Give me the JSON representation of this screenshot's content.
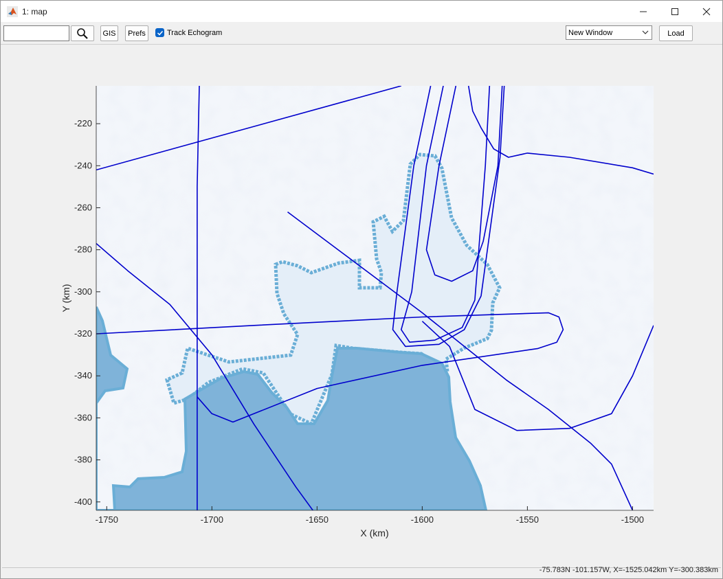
{
  "window": {
    "title": "1: map"
  },
  "toolbar": {
    "search_value": "",
    "gis_label": "GIS",
    "prefs_label": "Prefs",
    "track_echogram_label": "Track Echogram",
    "track_echogram_checked": true,
    "new_window_select": "New Window",
    "load_label": "Load"
  },
  "status": {
    "text": "-75.783N -101.157W, X=-1525.042km Y=-300.383km"
  },
  "colors": {
    "track": "#0000cc",
    "ocean": "#7fb3d9",
    "ice_shelf": "#e4eef8",
    "coast_edge": "#6aaed6",
    "land": "#f3f6fb"
  },
  "chart_data": {
    "type": "map",
    "xlabel": "X (km)",
    "ylabel": "Y (km)",
    "xlim": [
      -1755,
      -1490
    ],
    "ylim": [
      -404,
      -202
    ],
    "x_ticks": [
      -1750,
      -1700,
      -1650,
      -1600,
      -1550,
      -1500
    ],
    "y_ticks": [
      -220,
      -240,
      -260,
      -280,
      -300,
      -320,
      -340,
      -360,
      -380,
      -400
    ],
    "tracks": [
      [
        [
          -1755,
          -242
        ],
        [
          -1610,
          -202
        ]
      ],
      [
        [
          -1706,
          -202
        ],
        [
          -1707,
          -250
        ],
        [
          -1707,
          -404
        ]
      ],
      [
        [
          -1755,
          -277
        ],
        [
          -1740,
          -290
        ],
        [
          -1720,
          -306
        ],
        [
          -1700,
          -330
        ],
        [
          -1680,
          -363
        ],
        [
          -1660,
          -393
        ],
        [
          -1652,
          -404
        ]
      ],
      [
        [
          -1755,
          -320
        ],
        [
          -1680,
          -316
        ],
        [
          -1600,
          -312
        ],
        [
          -1540,
          -310
        ],
        [
          -1535,
          -312
        ],
        [
          -1533,
          -318
        ],
        [
          -1536,
          -324
        ],
        [
          -1545,
          -327
        ],
        [
          -1600,
          -335
        ],
        [
          -1650,
          -346
        ],
        [
          -1690,
          -362
        ],
        [
          -1700,
          -358
        ],
        [
          -1707,
          -350
        ]
      ],
      [
        [
          -1664,
          -262
        ],
        [
          -1640,
          -280
        ],
        [
          -1600,
          -310
        ],
        [
          -1560,
          -342
        ],
        [
          -1540,
          -356
        ],
        [
          -1520,
          -372
        ],
        [
          -1510,
          -382
        ],
        [
          -1500,
          -404
        ]
      ],
      [
        [
          -1590,
          -202
        ],
        [
          -1598,
          -240
        ],
        [
          -1605,
          -300
        ],
        [
          -1610,
          -318
        ],
        [
          -1606,
          -324
        ],
        [
          -1594,
          -323
        ],
        [
          -1581,
          -317
        ],
        [
          -1575,
          -304
        ],
        [
          -1570,
          -240
        ],
        [
          -1568,
          -202
        ]
      ],
      [
        [
          -1596,
          -202
        ],
        [
          -1604,
          -240
        ],
        [
          -1612,
          -300
        ],
        [
          -1614,
          -318
        ],
        [
          -1608,
          -326
        ],
        [
          -1592,
          -325
        ],
        [
          -1580,
          -318
        ],
        [
          -1572,
          -302
        ],
        [
          -1563,
          -236
        ],
        [
          -1561,
          -202
        ]
      ],
      [
        [
          -1584,
          -202
        ],
        [
          -1592,
          -240
        ],
        [
          -1598,
          -280
        ],
        [
          -1594,
          -292
        ],
        [
          -1586,
          -295
        ],
        [
          -1576,
          -290
        ],
        [
          -1571,
          -276
        ],
        [
          -1564,
          -240
        ],
        [
          -1562,
          -202
        ]
      ],
      [
        [
          -1578,
          -202
        ],
        [
          -1576,
          -214
        ],
        [
          -1572,
          -222
        ],
        [
          -1566,
          -232
        ],
        [
          -1559,
          -236
        ],
        [
          -1550,
          -234
        ],
        [
          -1530,
          -236
        ],
        [
          -1500,
          -241
        ],
        [
          -1490,
          -244
        ]
      ],
      [
        [
          -1490,
          -316
        ],
        [
          -1500,
          -340
        ],
        [
          -1510,
          -358
        ],
        [
          -1530,
          -365
        ],
        [
          -1555,
          -366
        ],
        [
          -1575,
          -356
        ],
        [
          -1587,
          -326
        ],
        [
          -1600,
          -314
        ]
      ]
    ]
  }
}
